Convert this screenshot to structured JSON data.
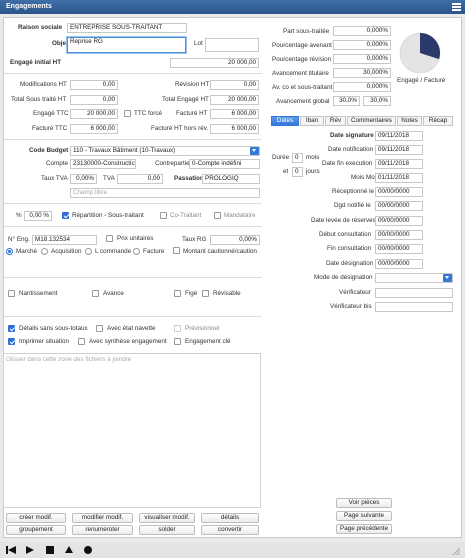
{
  "window": {
    "title": "Engagements"
  },
  "left": {
    "raison_sociale_label": "Raison sociale",
    "raison_sociale": "ENTREPRISE SOUS-TRAITANT",
    "objet_label": "Objet",
    "objet": "Reprise RG",
    "lot_label": "Lot",
    "lot": "",
    "engage_initial_label": "Engagé initial HT",
    "engage_initial": "20 000,00",
    "modifications_label": "Modifications HT",
    "modifications": "0,00",
    "revision_label": "Révision HT",
    "revision": "0,00",
    "total_st_label": "Total Sous traité HT",
    "total_st": "0,00",
    "total_engage_label": "Total Engagé HT",
    "total_engage": "20 000,00",
    "engage_ttc_label": "Engagé TTC",
    "engage_ttc": "20 000,00",
    "ttc_force_label": "TTC forcé",
    "facture_ht_label": "Facturé HT",
    "facture_ht": "6 000,00",
    "facture_ttc_label": "Facturé TTC",
    "facture_ttc": "6 000,00",
    "facture_hr_label": "Facturé HT hors rév.",
    "facture_hr": "6 000,00",
    "code_budget_label": "Code Budget",
    "code_budget": "110 - Travaux Bâtiment (10-Travaux)",
    "compte_label": "Compte",
    "compte": "23130000-Constructic",
    "contrepartie_label": "Contrepartie",
    "contrepartie": "0-Compte indéfini",
    "taux_tva_label": "Taux TVA",
    "taux_tva": "0,00%",
    "tva_label": "TVA",
    "tva": "0,00",
    "passation_label": "Passation",
    "passation": "PROLOGIQ",
    "champ_libre_placeholder": "Champ libre",
    "pct_label": "%",
    "pct": "0,00 %",
    "repartition_label": "Répartition - Sous-traitant",
    "cotraitant_label": "Co-Traitant",
    "mandataire_label": "Mandataire",
    "neng_label": "N° Eng.",
    "neng": "M18.132534",
    "prix_unitaires_label": "Prix unitaires",
    "taux_rg_label": "Taux RG",
    "taux_rg": "0,00%",
    "marche_label": "Marché",
    "acquisition_label": "Acquisition",
    "lcommande_label": "L commande",
    "facture_label": "Facture",
    "montant_caution_label": "Montant cautionné/caution",
    "nantissement_label": "Nantissement",
    "avance_label": "Avance",
    "fige_label": "Figé",
    "revisable_label": "Révisable",
    "details_st_label": "Détails sans sous-totaux",
    "etat_navette_label": "Avec état navette",
    "previsionnel_label": "Prévisionnel",
    "imprimer_label": "Imprimer situation",
    "synthese_label": "Avec synthèse engagement",
    "engagement_cle_label": "Engagement clé",
    "drop_hint": "Glisser dans cette zone des fichiers à joindre"
  },
  "right": {
    "part_st_label": "Part sous-traitée",
    "part_st": "0,000%",
    "pct_avenant_label": "Pourcentage avenant",
    "pct_avenant": "0,000%",
    "pct_revision_label": "Pourcentage révision",
    "pct_revision": "0,000%",
    "avancement_tit_label": "Avancement titulaire",
    "avancement_tit": "30,000%",
    "av_co_label": "Av. co et sous-traitant",
    "av_co": "0,000%",
    "av_global_label": "Avancement global",
    "av_global_1": "30,0%",
    "av_global_2": "30,0%",
    "pie_label": "Engagé / Facturé"
  },
  "tabs": [
    "Dates",
    "Iban",
    "Rév",
    "Commentaires",
    "Notes",
    "Récap"
  ],
  "dates": {
    "date_signature_label": "Date signature",
    "date_signature": "09/11/2018",
    "date_notification_label": "Date notification",
    "date_notification": "09/11/2018",
    "duree_label": "Durée",
    "duree_mois": "0",
    "mois_label": "mois",
    "et_label": "et",
    "duree_jours": "0",
    "jours_label": "jours",
    "date_fin_label": "Date fin execution",
    "date_fin": "09/11/2018",
    "mois_mo_label": "Mois Mo",
    "mois_mo": "01/11/2018",
    "reception_label": "Réceptionné le",
    "reception": "00/00/0000",
    "dgd_label": "Dgd notifié le",
    "dgd": "00/00/0000",
    "levee_label": "Date levée de réserves",
    "levee": "00/00/0000",
    "debut_consult_label": "Début consultation",
    "debut_consult": "00/00/0000",
    "fin_consult_label": "Fin consultation",
    "fin_consult": "00/00/0000",
    "date_designation_label": "Date désignation",
    "date_designation": "00/00/0000",
    "mode_designation_label": "Mode de désignation",
    "mode_designation": "",
    "verificateur_label": "Vérificateur",
    "verificateur": "",
    "verificateur_bis_label": "Vérificateur bis",
    "verificateur_bis": ""
  },
  "buttons": {
    "voir_pieces": "Voir pièces",
    "page_suivante": "Page suivante",
    "page_precedente": "Page précédente",
    "creer_modif": "créer modif.",
    "modifier_modif": "modifier modif.",
    "visualiser_modif": "visualiser modif.",
    "details": "détails",
    "groupement": "groupement",
    "renumeroter": "renumeroter",
    "solder": "solder",
    "convertir": "convertir"
  },
  "colors": {
    "accent": "#3478d8",
    "title_bar": "#2a568b",
    "pie_filled": "#2b3a6b",
    "pie_empty": "#e4e4e4"
  }
}
